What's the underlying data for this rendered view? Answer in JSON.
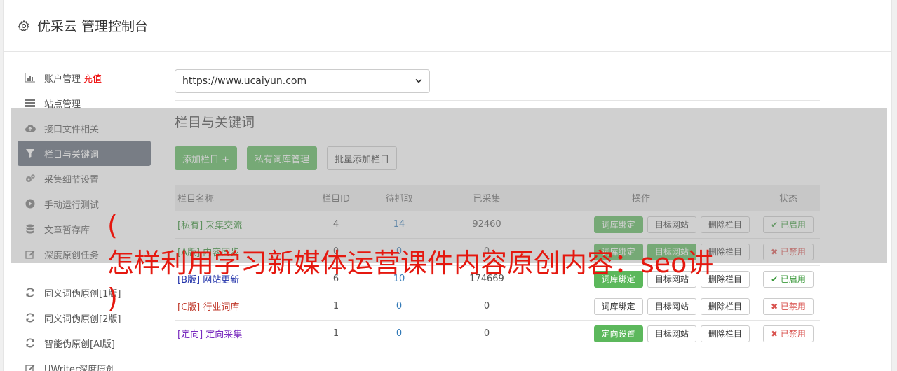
{
  "header": {
    "title": "优采云 管理控制台",
    "icon": "gear-icon"
  },
  "sidebar": {
    "items": [
      {
        "label": "账户管理",
        "extra": "充值",
        "icon": "bar-chart-icon"
      },
      {
        "label": "站点管理",
        "icon": "server-icon"
      },
      {
        "label": "接口文件相关",
        "icon": "cloud-upload-icon"
      },
      {
        "label": "栏目与关键词",
        "icon": "filter-icon",
        "active": true
      },
      {
        "label": "采集细节设置",
        "icon": "cogs-icon"
      },
      {
        "label": "手动运行测试",
        "icon": "play-circle-icon"
      },
      {
        "label": "文章暂存库",
        "icon": "database-icon"
      },
      {
        "label": "深度原创任务",
        "icon": "edit-icon"
      }
    ],
    "items2": [
      {
        "label": "同义词伪原创[1版]",
        "icon": "refresh-icon"
      },
      {
        "label": "同义词伪原创[2版]",
        "icon": "refresh-icon"
      },
      {
        "label": "智能伪原创[AI版]",
        "icon": "refresh-icon"
      },
      {
        "label": "UWriter深度原创",
        "icon": "edit-icon"
      }
    ]
  },
  "main": {
    "site_select": "https://www.ucaiyun.com",
    "section_title": "栏目与关键词",
    "buttons": {
      "add": "添加栏目 +",
      "private": "私有词库管理",
      "batch": "批量添加栏目"
    },
    "table": {
      "headers": [
        "栏目名称",
        "栏目ID",
        "待抓取",
        "已采集",
        "操作",
        "状态"
      ],
      "rows": [
        {
          "tag": "[私有]",
          "name": "采集交流",
          "id": "4",
          "pending": "14",
          "collected": "92460",
          "op1": "词库绑定",
          "op2": "目标网站",
          "op3": "删除栏目",
          "status": "✔ 已启用"
        },
        {
          "tag": "[A版]",
          "name": "内容同步",
          "id": "0",
          "pending": "0",
          "collected": "0",
          "op1": "词库绑定",
          "op2": "目标网站",
          "op3": "删除栏目",
          "status": "✖ 已禁用"
        },
        {
          "tag": "[B版]",
          "name": "网站更新",
          "id": "6",
          "pending": "10",
          "collected": "174669",
          "op1": "词库绑定",
          "op2": "目标网站",
          "op3": "删除栏目",
          "status": "✔ 已启用"
        },
        {
          "tag": "[C版]",
          "name": "行业词库",
          "id": "1",
          "pending": "0",
          "collected": "0",
          "op1": "词库绑定",
          "op2": "目标网站",
          "op3": "删除栏目",
          "status": "✖ 已禁用"
        },
        {
          "tag": "[定向]",
          "name": "定向采集",
          "id": "1",
          "pending": "0",
          "collected": "0",
          "op1": "定向设置",
          "op2": "目标网站",
          "op3": "删除栏目",
          "status": "✖ 已禁用"
        }
      ]
    }
  },
  "overlay": {
    "line1": "(",
    "line2": "怎样利用学习新媒体运营课件内容原创内容：seo讲",
    "line3": ")"
  },
  "colors": {
    "green": "#5cb85c",
    "active_bg": "#5f6877",
    "red_text": "#e5180f"
  }
}
